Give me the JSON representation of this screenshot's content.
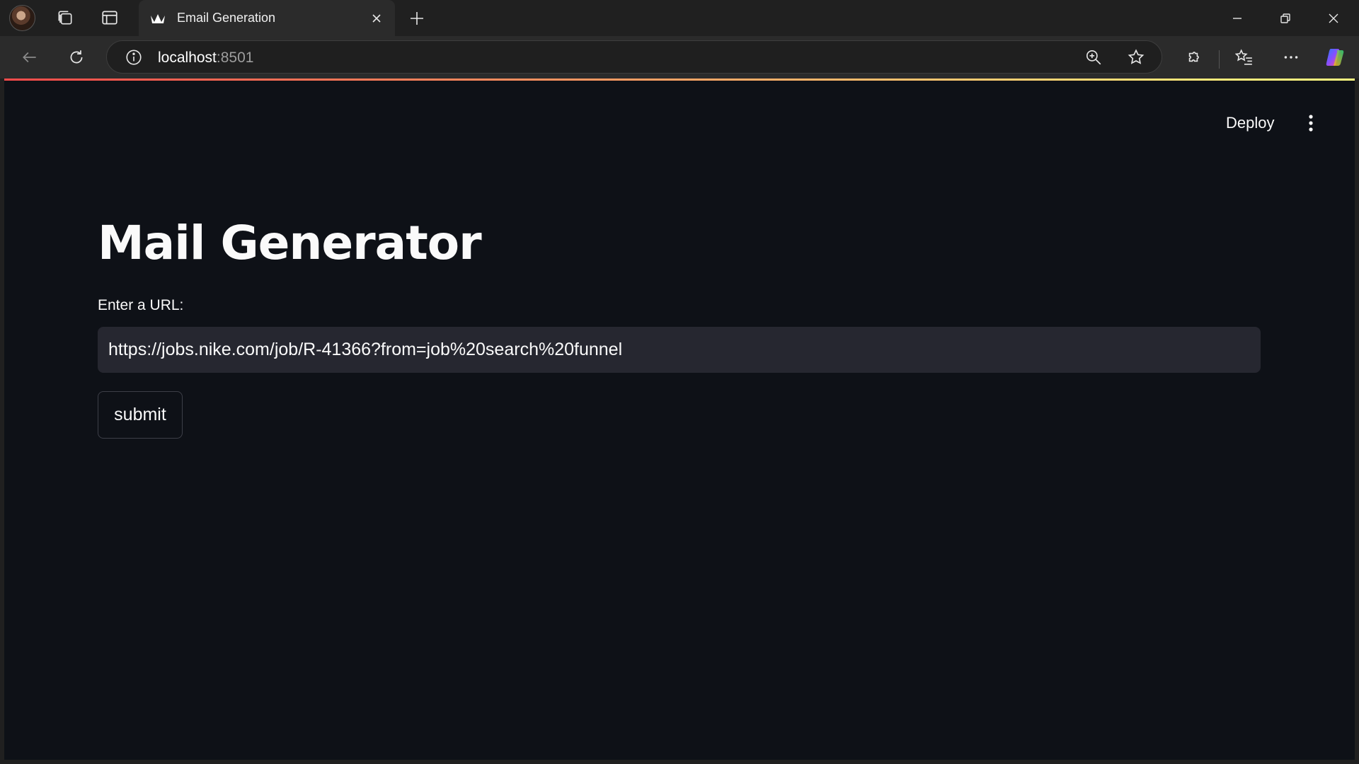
{
  "browser": {
    "tab": {
      "title": "Email Generation",
      "favicon": "streamlit-crown-icon"
    },
    "address": {
      "host": "localhost",
      "port": ":8501"
    },
    "icons": {
      "profile": "profile-avatar",
      "collections": "collections-icon",
      "vertical_tabs": "tab-actions-icon",
      "new_tab": "plus-icon",
      "back": "back-arrow-icon",
      "refresh": "refresh-icon",
      "site_info": "info-icon",
      "zoom": "zoom-in-icon",
      "favorite": "star-icon",
      "extensions": "puzzle-icon",
      "favorites": "favorites-list-icon",
      "more": "ellipsis-icon",
      "copilot": "copilot-icon"
    }
  },
  "app": {
    "header": {
      "deploy_label": "Deploy"
    },
    "title": "Mail Generator",
    "url_field": {
      "label": "Enter a URL:",
      "value": "https://jobs.nike.com/job/R-41366?from=job%20search%20funnel"
    },
    "submit_label": "submit"
  },
  "colors": {
    "page_bg": "#0e1117",
    "input_bg": "#262730",
    "text": "#fafafa",
    "accent_gradient_start": "#ff4b4b",
    "accent_gradient_end": "#fffd80"
  }
}
